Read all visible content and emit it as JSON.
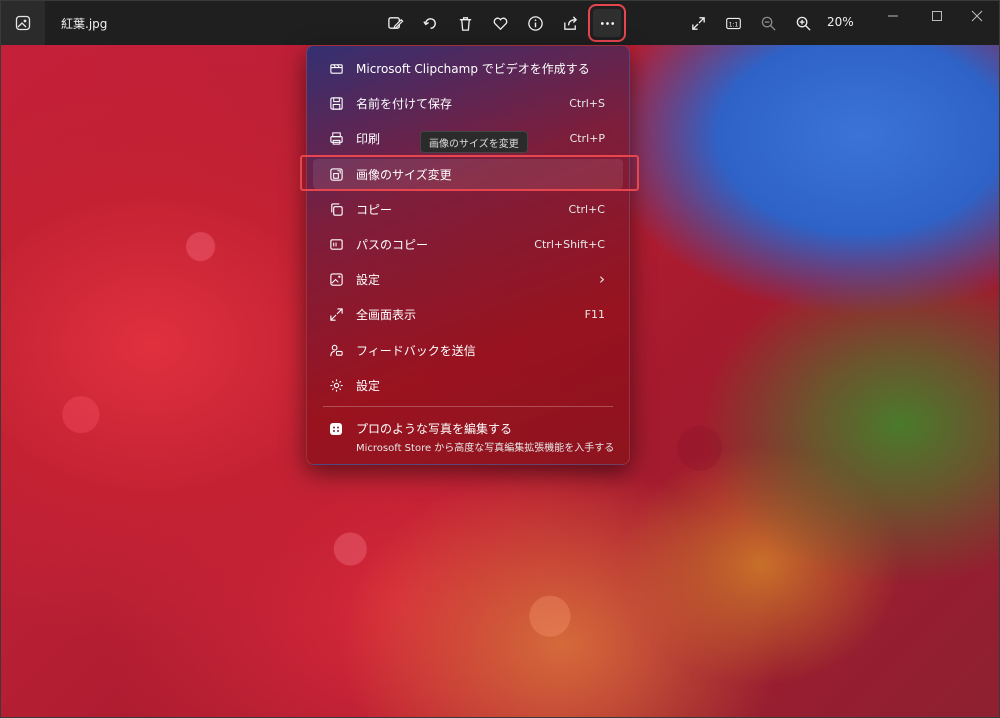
{
  "window": {
    "file_name": "紅葉.jpg",
    "zoom": "20%"
  },
  "toolbar": {
    "icons": [
      "edit-image-icon",
      "rotate-icon",
      "delete-icon",
      "favorite-icon",
      "info-icon",
      "share-icon",
      "more-icon"
    ],
    "right_icons": [
      "fullscreen-icon",
      "actual-size-icon",
      "zoom-out-icon",
      "zoom-in-icon"
    ],
    "actual_size_label": "1:1"
  },
  "menu": {
    "items": [
      {
        "label": "Microsoft Clipchamp でビデオを作成する",
        "shortcut": "",
        "icon": "clipchamp-icon"
      },
      {
        "label": "名前を付けて保存",
        "shortcut": "Ctrl+S",
        "icon": "save-icon"
      },
      {
        "label": "印刷",
        "shortcut": "Ctrl+P",
        "icon": "print-icon"
      },
      {
        "label": "画像のサイズ変更",
        "shortcut": "",
        "icon": "resize-icon"
      },
      {
        "label": "コピー",
        "shortcut": "Ctrl+C",
        "icon": "copy-icon"
      },
      {
        "label": "パスのコピー",
        "shortcut": "Ctrl+Shift+C",
        "icon": "copy-path-icon"
      },
      {
        "label": "設定",
        "shortcut": "",
        "icon": "set-as-icon",
        "arrow": "›"
      },
      {
        "label": "全画面表示",
        "shortcut": "F11",
        "icon": "fullscreen-icon"
      },
      {
        "label": "フィードバックを送信",
        "shortcut": "",
        "icon": "feedback-icon"
      },
      {
        "label": "設定",
        "shortcut": "",
        "icon": "settings-icon"
      }
    ],
    "tooltip": "画像のサイズを変更",
    "promo": {
      "title": "プロのような写真を編集する",
      "subtitle": "Microsoft Store から高度な写真編集拡張機能を入手する"
    }
  },
  "colors": {
    "highlight": "#e8464f",
    "titlebar": "#1f1f1f"
  }
}
